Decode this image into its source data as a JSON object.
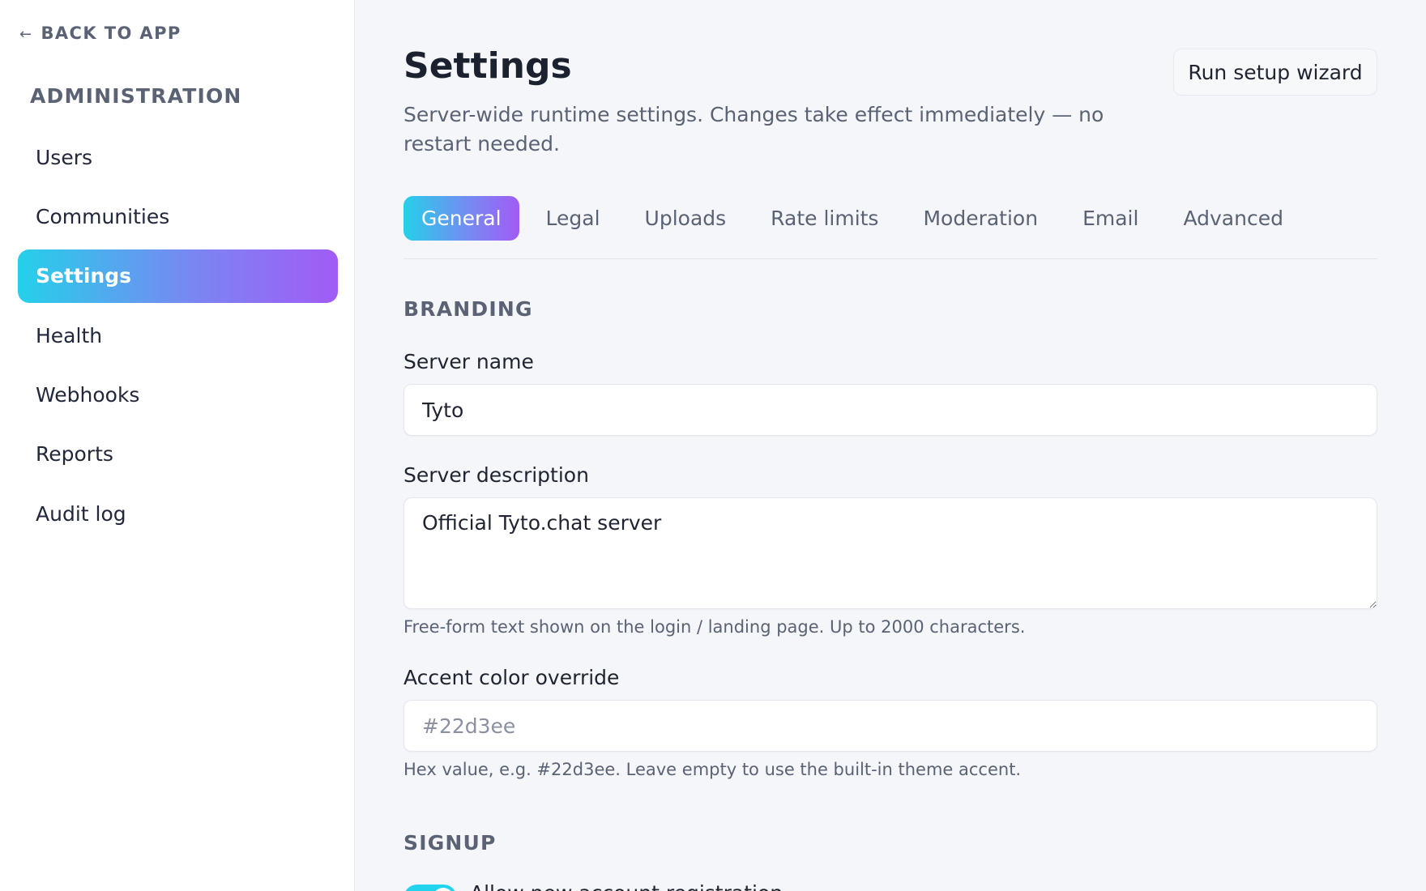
{
  "sidebar": {
    "back_label": "BACK TO APP",
    "back_icon": "arrow-left-icon",
    "heading": "ADMINISTRATION",
    "items": [
      {
        "label": "Users"
      },
      {
        "label": "Communities"
      },
      {
        "label": "Settings",
        "active": true
      },
      {
        "label": "Health"
      },
      {
        "label": "Webhooks"
      },
      {
        "label": "Reports"
      },
      {
        "label": "Audit log"
      }
    ]
  },
  "header": {
    "title": "Settings",
    "subtitle": "Server-wide runtime settings. Changes take effect immediately — no restart needed.",
    "wizard_button": "Run setup wizard"
  },
  "tabs": [
    {
      "label": "General",
      "active": true
    },
    {
      "label": "Legal"
    },
    {
      "label": "Uploads"
    },
    {
      "label": "Rate limits"
    },
    {
      "label": "Moderation"
    },
    {
      "label": "Email"
    },
    {
      "label": "Advanced"
    }
  ],
  "branding": {
    "heading": "BRANDING",
    "server_name": {
      "label": "Server name",
      "value": "Tyto"
    },
    "server_description": {
      "label": "Server description",
      "value": "Official Tyto.chat server",
      "help": "Free-form text shown on the login / landing page. Up to 2000 characters."
    },
    "accent_color": {
      "label": "Accent color override",
      "value": "",
      "placeholder": "#22d3ee",
      "help": "Hex value, e.g. #22d3ee. Leave empty to use the built-in theme accent."
    }
  },
  "signup": {
    "heading": "SIGNUP",
    "toggle_label": "Allow new account registration",
    "toggle_on": true
  },
  "colors": {
    "accent_cyan": "#22d3ee",
    "accent_purple": "#a25bf5",
    "background": "#f4f6f9",
    "muted_text": "#5a6274"
  }
}
